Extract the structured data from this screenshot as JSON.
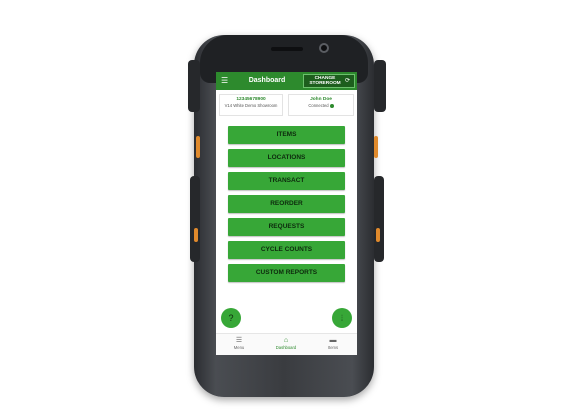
{
  "header": {
    "title": "Dashboard",
    "change_button": "CHANGE STOREROOM"
  },
  "storeroom": {
    "id": "12345678900",
    "name": "V14 White Demo Showroom"
  },
  "user": {
    "name": "John Doe",
    "status": "Connected"
  },
  "menu": [
    {
      "label": "ITEMS"
    },
    {
      "label": "LOCATIONS"
    },
    {
      "label": "TRANSACT"
    },
    {
      "label": "REORDER"
    },
    {
      "label": "REQUESTS"
    },
    {
      "label": "CYCLE COUNTS"
    },
    {
      "label": "CUSTOM REPORTS"
    }
  ],
  "bottom_nav": [
    {
      "label": "Menu",
      "icon": "list-icon"
    },
    {
      "label": "Dashboard",
      "icon": "home-icon",
      "active": true
    },
    {
      "label": "Items",
      "icon": "box-icon"
    }
  ],
  "colors": {
    "header": "#2d8a2d",
    "button": "#37a737",
    "accent": "#2d8a2d"
  }
}
